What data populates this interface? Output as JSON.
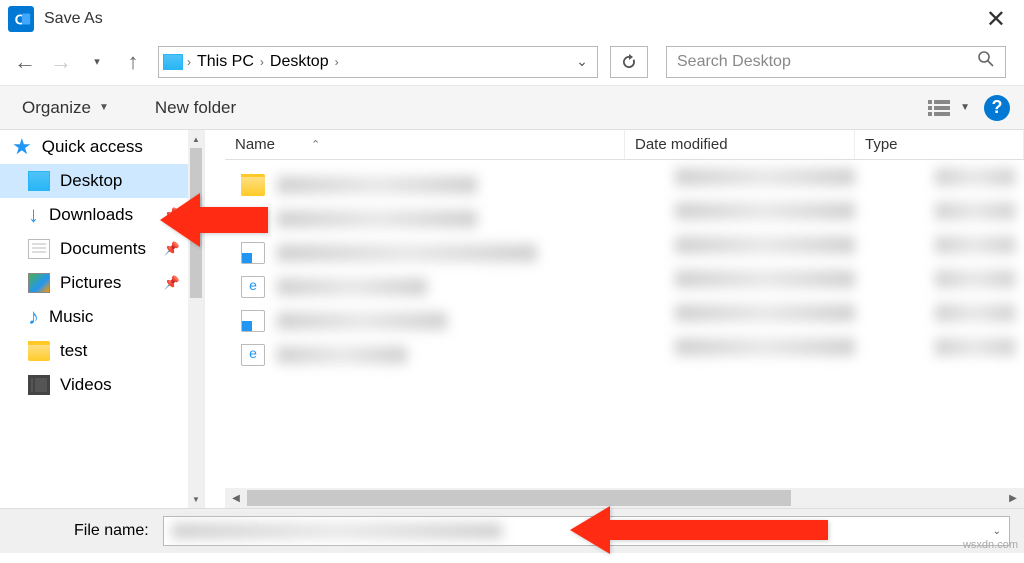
{
  "title": "Save As",
  "breadcrumb": {
    "pc": "This PC",
    "loc": "Desktop"
  },
  "search": {
    "placeholder": "Search Desktop"
  },
  "toolbar": {
    "organize": "Organize",
    "newfolder": "New folder"
  },
  "columns": {
    "name": "Name",
    "date": "Date modified",
    "type": "Type"
  },
  "sidebar": {
    "quick": "Quick access",
    "desktop": "Desktop",
    "downloads": "Downloads",
    "documents": "Documents",
    "pictures": "Pictures",
    "music": "Music",
    "test": "test",
    "videos": "Videos"
  },
  "filename": {
    "label": "File name:"
  },
  "watermark": "wsxdn.com"
}
